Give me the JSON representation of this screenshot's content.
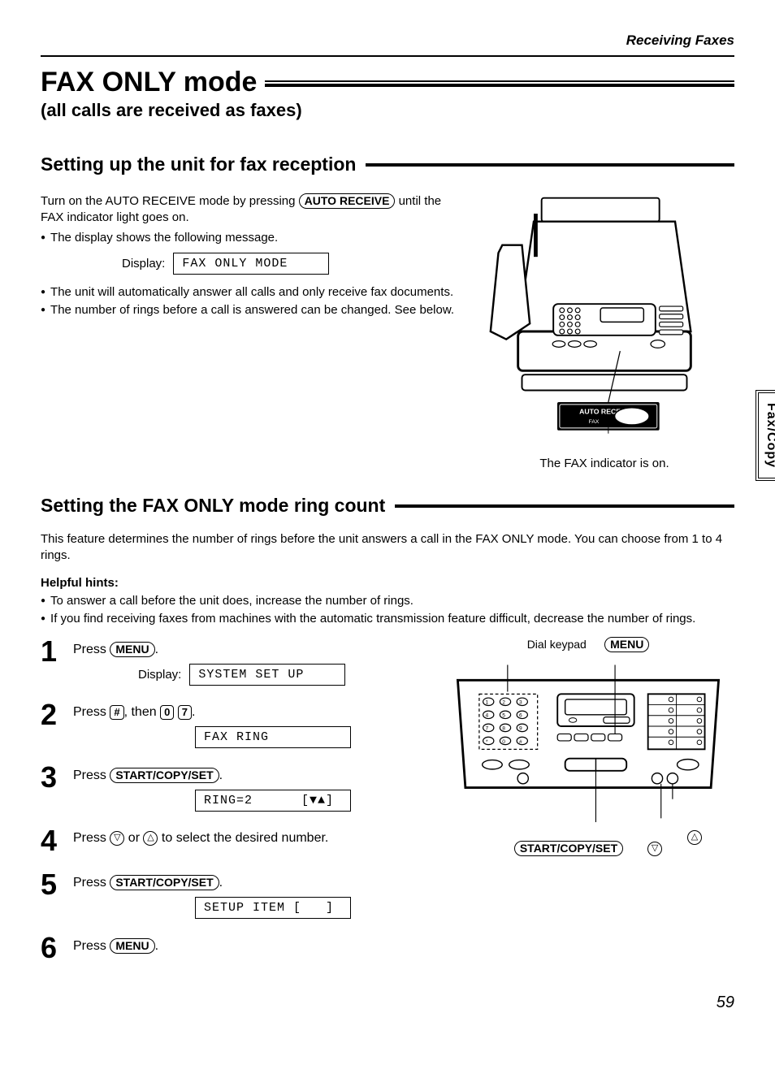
{
  "runningHead": "Receiving Faxes",
  "title": "FAX ONLY mode",
  "subtitle": "(all calls are received as faxes)",
  "section1": {
    "heading": "Setting up the unit for fax reception",
    "intro_line1": "Turn on the AUTO RECEIVE mode by pressing",
    "auto_receive_key": "AUTO RECEIVE",
    "intro_line1_cont": " until the FAX indicator light goes on.",
    "bullet1": "The display shows the following message.",
    "displayLabel": "Display:",
    "displayValue": "FAX ONLY MODE",
    "bullet2": "The unit will automatically answer all calls and only receive fax documents.",
    "bullet3": "The number of rings before a call is answered can be changed. See below.",
    "illustration_panel_label": "AUTO RECEIVE",
    "illustration_fax_label": "FAX",
    "caption": "The FAX indicator is on."
  },
  "sideTab": "Fax/Copy",
  "section2": {
    "heading": "Setting the FAX ONLY mode ring count",
    "para": "This feature determines the number of rings before the unit answers a call in the FAX ONLY mode. You can choose from 1 to 4 rings.",
    "hintsHead": "Helpful hints:",
    "hint1": "To answer a call before the unit does, increase the number of rings.",
    "hint2": "If you find receiving faxes from machines with the automatic transmission feature difficult, decrease the number of rings.",
    "steps": [
      {
        "num": "1",
        "text_a": "Press ",
        "key": "MENU",
        "text_b": ".",
        "dispLabel": "Display:",
        "lcd": "SYSTEM SET UP"
      },
      {
        "num": "2",
        "text_a": "Press ",
        "key1": "#",
        "text_b": ", then ",
        "key2": "0",
        "key3": "7",
        "text_c": ".",
        "lcd": "FAX RING"
      },
      {
        "num": "3",
        "text_a": "Press ",
        "key": "START/COPY/SET",
        "text_b": ".",
        "lcd": "RING=2      [▼▲]"
      },
      {
        "num": "4",
        "text_a": "Press ",
        "arrow_down": "▽",
        "text_mid": " or ",
        "arrow_up": "△",
        "text_b": " to select the desired number."
      },
      {
        "num": "5",
        "text_a": "Press ",
        "key": "START/COPY/SET",
        "text_b": ".",
        "lcd": "SETUP ITEM [   ]"
      },
      {
        "num": "6",
        "text_a": "Press ",
        "key": "MENU",
        "text_b": "."
      }
    ],
    "panel": {
      "dialLabel": "Dial keypad",
      "menuLabel": "MENU",
      "startLabel": "START/COPY/SET",
      "arrow_up": "△",
      "arrow_down": "▽"
    }
  },
  "pageNumber": "59"
}
